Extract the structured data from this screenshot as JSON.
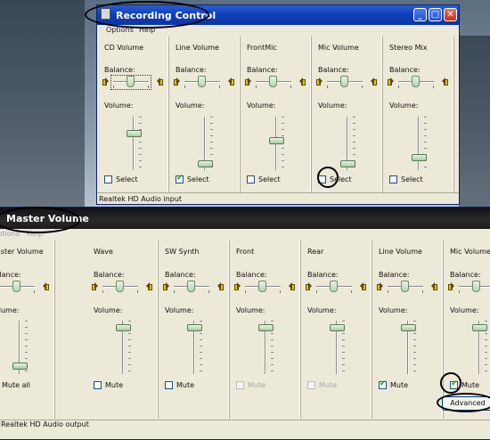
{
  "recording": {
    "title": "Recording Control",
    "menu": [
      "Options",
      "Help"
    ],
    "balance_label": "Balance:",
    "volume_label": "Volume:",
    "columns": [
      {
        "name": "CD Volume",
        "select_label": "Select",
        "checked": false,
        "balance": 0.5,
        "volume": 0.72,
        "focused": true
      },
      {
        "name": "Line Volume",
        "select_label": "Select",
        "checked": true,
        "balance": 0.5,
        "volume": 0.05,
        "focused": false
      },
      {
        "name": "FrontMic",
        "select_label": "Select",
        "checked": false,
        "balance": 0.5,
        "volume": 0.55,
        "focused": false
      },
      {
        "name": "Mic Volume",
        "select_label": "Select",
        "checked": false,
        "balance": 0.5,
        "volume": 0.05,
        "focused": false
      },
      {
        "name": "Stereo Mix",
        "select_label": "Select",
        "checked": false,
        "balance": 0.5,
        "volume": 0.2,
        "focused": false
      }
    ],
    "status": "Realtek HD Audio input"
  },
  "master": {
    "title": "Master Volume",
    "menu": [
      "Options",
      "Help"
    ],
    "balance_label": "Balance:",
    "volume_label": "Volume:",
    "columns": [
      {
        "name": "Master Volume",
        "check_label": "Mute all",
        "checked": false,
        "disabled": false,
        "balance": 0.5,
        "volume": 0.1
      },
      {
        "name": "Wave",
        "check_label": "Mute",
        "checked": false,
        "disabled": false,
        "balance": 0.5,
        "volume": 0.92
      },
      {
        "name": "SW Synth",
        "check_label": "Mute",
        "checked": false,
        "disabled": false,
        "balance": 0.5,
        "volume": 0.92
      },
      {
        "name": "Front",
        "check_label": "Mute",
        "checked": false,
        "disabled": true,
        "balance": 0.5,
        "volume": 0.92
      },
      {
        "name": "Rear",
        "check_label": "Mute",
        "checked": false,
        "disabled": true,
        "balance": 0.5,
        "volume": 0.92
      },
      {
        "name": "Line Volume",
        "check_label": "Mute",
        "checked": true,
        "disabled": false,
        "balance": 0.5,
        "volume": 0.92
      },
      {
        "name": "Mic Volume",
        "check_label": "Mute",
        "checked": true,
        "disabled": false,
        "balance": 0.5,
        "volume": 0.92
      }
    ],
    "advanced_label": "Advanced",
    "status": "Realtek HD Audio output"
  }
}
